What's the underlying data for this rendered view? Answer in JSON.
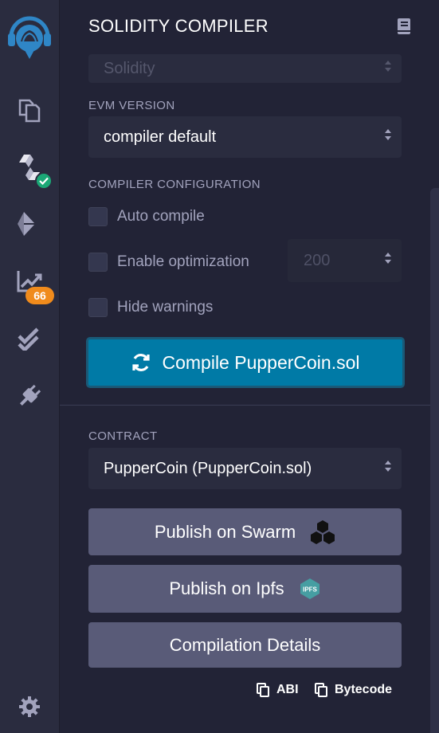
{
  "panel": {
    "title": "SOLIDITY COMPILER",
    "language_select": "Solidity",
    "evm_label": "EVM VERSION",
    "evm_select": "compiler default",
    "config_label": "COMPILER CONFIGURATION",
    "auto_compile": "Auto compile",
    "enable_optimization": "Enable optimization",
    "optimization_runs": "200",
    "hide_warnings": "Hide warnings",
    "compile_button": "Compile PupperCoin.sol",
    "contract_label": "CONTRACT",
    "contract_select": "PupperCoin (PupperCoin.sol)",
    "publish_swarm": "Publish on Swarm",
    "publish_ipfs": "Publish on Ipfs",
    "compilation_details": "Compilation Details",
    "abi_link": "ABI",
    "bytecode_link": "Bytecode"
  },
  "rail": {
    "analysis_badge": "66",
    "ipfs_logo_text": "IPFS",
    "items": [
      "remix-logo-icon",
      "file-explorer-icon",
      "solidity-compiler-icon",
      "deploy-run-icon",
      "analysis-icon",
      "testing-icon",
      "plugin-manager-icon",
      "settings-icon"
    ]
  },
  "colors": {
    "background": "#222336",
    "rail": "#2a2c3f",
    "compile_button": "#007aa6",
    "action_button": "#595b78",
    "success_badge": "#1ba876",
    "warning_badge": "#f08b1c",
    "logo_blue": "#2f86c6"
  }
}
